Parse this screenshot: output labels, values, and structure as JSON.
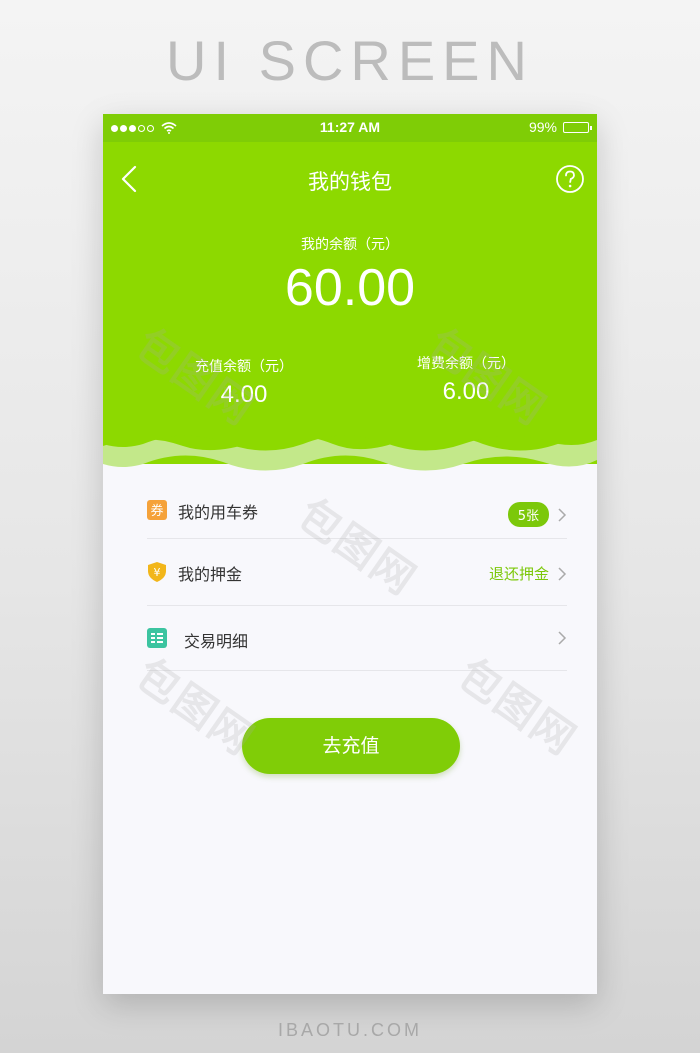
{
  "poster": {
    "title": "UI SCREEN",
    "footer": "IBAOTU.COM"
  },
  "status_bar": {
    "time": "11:27 AM",
    "battery": "99%"
  },
  "nav": {
    "title": "我的钱包"
  },
  "balance": {
    "label": "我的余额（元）",
    "amount": "60.00"
  },
  "sub_balances": [
    {
      "label": "充值余额（元）",
      "value": "4.00"
    },
    {
      "label": "增费余额（元）",
      "value": "6.00"
    }
  ],
  "menu": [
    {
      "label": "我的用车券",
      "icon": "coupon-icon",
      "badge": "5张",
      "icon_text": "券"
    },
    {
      "label": "我的押金",
      "icon": "deposit-shield-icon",
      "link": "退还押金",
      "icon_text": "¥"
    },
    {
      "label": "交易明细",
      "icon": "transaction-list-icon"
    }
  ],
  "cta": {
    "label": "去充值"
  },
  "watermark": {
    "text": "包图网"
  },
  "colors": {
    "brand_green": "#8dd900",
    "status_green": "#7fcd06",
    "button_green": "#80cd07",
    "coupon_orange": "#f5a23a",
    "shield_yellow": "#f2b61a",
    "list_teal": "#3cc4a0"
  }
}
